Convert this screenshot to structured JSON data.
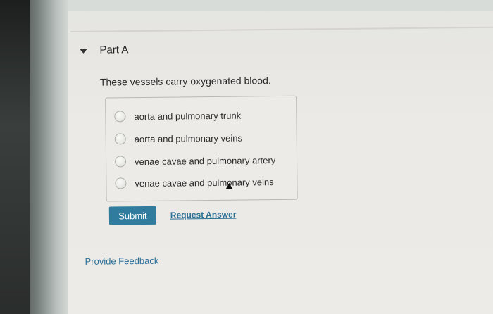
{
  "part": {
    "title": "Part A",
    "toggle_icon": "caret-down-icon"
  },
  "question": {
    "text": "These vessels carry oxygenated blood."
  },
  "options": [
    {
      "label": "aorta and pulmonary trunk",
      "selected": false
    },
    {
      "label": "aorta and pulmonary veins",
      "selected": false
    },
    {
      "label": "venae cavae and pulmonary artery",
      "selected": false
    },
    {
      "label": "venae cavae and pulmonary veins",
      "selected": false
    }
  ],
  "actions": {
    "submit_label": "Submit",
    "request_answer_label": "Request Answer"
  },
  "footer": {
    "feedback_label": "Provide Feedback"
  },
  "colors": {
    "submit_bg": "#2f7c9e",
    "link": "#2b6f95"
  }
}
